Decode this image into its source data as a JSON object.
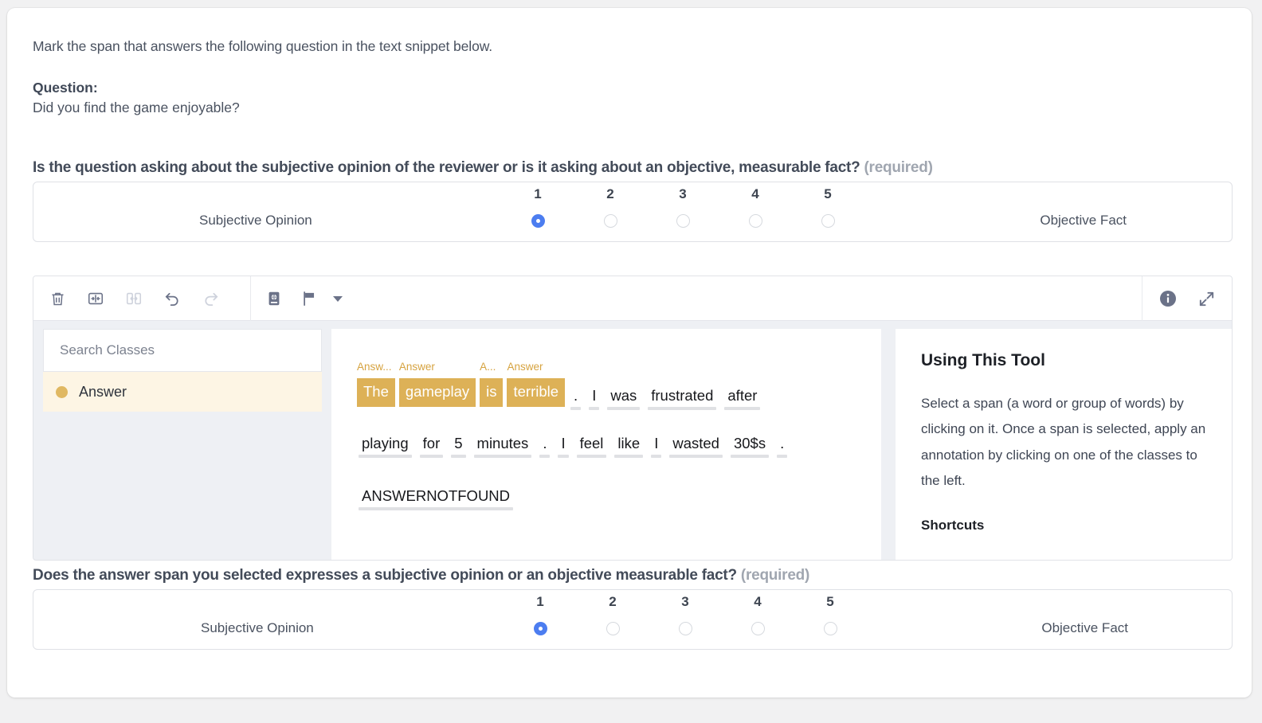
{
  "instructions": {
    "prompt": "Mark the span that answers the following question in the text snippet below.",
    "question_label": "Question:",
    "question_text": "Did you find the game enjoyable?"
  },
  "question_top": {
    "heading": "Is the question asking about the subjective opinion of the reviewer or is it asking about an objective, measurable fact?",
    "required_tag": "(required)",
    "left_label": "Subjective Opinion",
    "right_label": "Objective Fact",
    "options": [
      "1",
      "2",
      "3",
      "4",
      "5"
    ],
    "selected": "1"
  },
  "question_bottom": {
    "heading": "Does the answer span you selected expresses a subjective opinion or an objective measurable fact?",
    "required_tag": "(required)",
    "left_label": "Subjective Opinion",
    "right_label": "Objective Fact",
    "options": [
      "1",
      "2",
      "3",
      "4",
      "5"
    ],
    "selected": "1"
  },
  "toolbar": {
    "buttons": [
      {
        "name": "delete-icon",
        "label": "Delete",
        "disabled": false
      },
      {
        "name": "merge-icon",
        "label": "Merge spans",
        "disabled": false
      },
      {
        "name": "split-icon",
        "label": "Split span",
        "disabled": true
      },
      {
        "name": "undo-icon",
        "label": "Undo",
        "disabled": false
      },
      {
        "name": "redo-icon",
        "label": "Redo",
        "disabled": true
      },
      {
        "name": "dictionary-icon",
        "label": "Dictionary",
        "disabled": false
      },
      {
        "name": "flag-icon",
        "label": "Flag",
        "disabled": false
      }
    ],
    "right_buttons": [
      {
        "name": "info-icon",
        "label": "Info"
      },
      {
        "name": "expand-icon",
        "label": "Expand"
      }
    ]
  },
  "classes_panel": {
    "search_placeholder": "Search Classes",
    "search_value": "",
    "items": [
      {
        "label": "Answer",
        "color": "#e0b862",
        "selected": true
      }
    ]
  },
  "snippet": {
    "lines": [
      [
        {
          "text": "The",
          "selected": true,
          "tag": "Answ..."
        },
        {
          "text": "gameplay",
          "selected": true,
          "tag": "Answer"
        },
        {
          "text": "is",
          "selected": true,
          "tag": "A..."
        },
        {
          "text": "terrible",
          "selected": true,
          "tag": "Answer"
        },
        {
          "text": ".",
          "selected": false,
          "tag": ""
        },
        {
          "text": "I",
          "selected": false,
          "tag": ""
        },
        {
          "text": "was",
          "selected": false,
          "tag": ""
        },
        {
          "text": "frustrated",
          "selected": false,
          "tag": ""
        },
        {
          "text": "after",
          "selected": false,
          "tag": ""
        }
      ],
      [
        {
          "text": "playing",
          "selected": false,
          "tag": ""
        },
        {
          "text": "for",
          "selected": false,
          "tag": ""
        },
        {
          "text": "5",
          "selected": false,
          "tag": ""
        },
        {
          "text": "minutes",
          "selected": false,
          "tag": ""
        },
        {
          "text": ".",
          "selected": false,
          "tag": ""
        },
        {
          "text": "I",
          "selected": false,
          "tag": ""
        },
        {
          "text": "feel",
          "selected": false,
          "tag": ""
        },
        {
          "text": "like",
          "selected": false,
          "tag": ""
        },
        {
          "text": "I",
          "selected": false,
          "tag": ""
        },
        {
          "text": "wasted",
          "selected": false,
          "tag": ""
        },
        {
          "text": "30$s",
          "selected": false,
          "tag": ""
        },
        {
          "text": ".",
          "selected": false,
          "tag": ""
        }
      ],
      [
        {
          "text": "ANSWERNOTFOUND",
          "selected": false,
          "tag": ""
        }
      ]
    ]
  },
  "help_panel": {
    "title": "Using This Tool",
    "body": "Select a span (a word or group of words) by clicking on it. Once a span is selected, apply an annotation by clicking on one of the classes to the left.",
    "shortcuts_title": "Shortcuts"
  },
  "colors": {
    "accent_blue": "#4c7df0",
    "span_highlight": "#ddb157",
    "class_dot": "#e0b862",
    "class_row_bg": "#fdf5e4"
  }
}
